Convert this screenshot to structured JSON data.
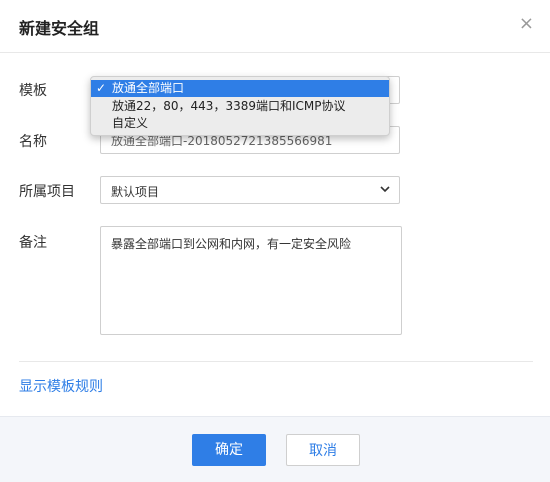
{
  "dialog": {
    "title": "新建安全组",
    "close_glyph": "×"
  },
  "form": {
    "template_label": "模板",
    "name_label": "名称",
    "name_value": "放通全部端口-20180527213855669​81",
    "project_label": "所属项目",
    "project_value": "默认项目",
    "remark_label": "备注",
    "remark_value": "暴露全部端口到公网和内网，有一定安全风险"
  },
  "dropdown": {
    "check_glyph": "✓",
    "options": [
      {
        "label": "放通全部端口",
        "selected": true
      },
      {
        "label": "放通22，80，443，3389端口和ICMP协议",
        "selected": false
      },
      {
        "label": "自定义",
        "selected": false
      }
    ]
  },
  "links": {
    "show_rules": "显示模板规则"
  },
  "footer": {
    "confirm_label": "确定",
    "cancel_label": "取消"
  },
  "colors": {
    "accent": "#2f7ee6"
  },
  "icons": {
    "close": "close-icon",
    "chevron": "chevron-down-icon",
    "check": "checkmark-icon"
  }
}
